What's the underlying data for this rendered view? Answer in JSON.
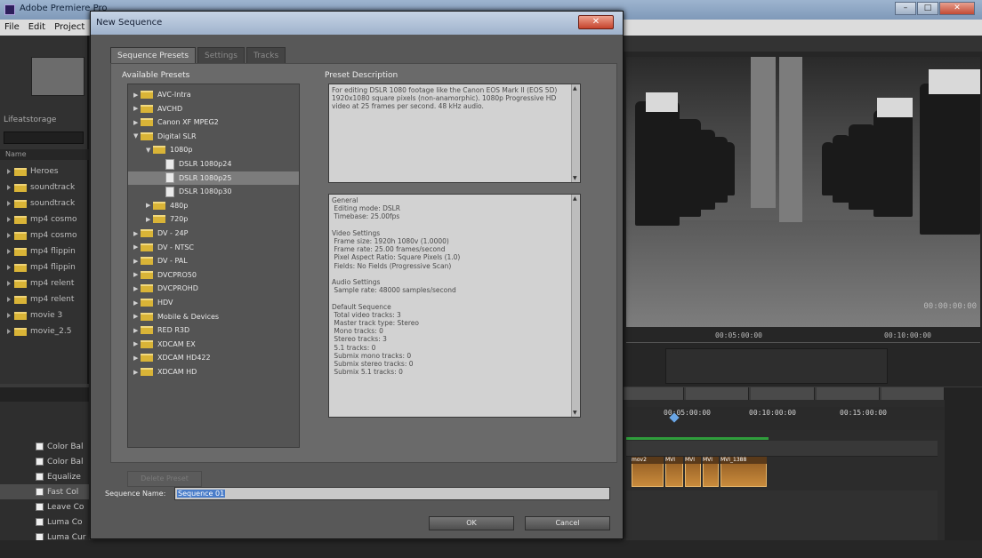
{
  "app": {
    "title": "Adobe Premiere Pro",
    "menu": [
      "File",
      "Edit",
      "Project"
    ],
    "window_controls": [
      "–",
      "□",
      "✕"
    ]
  },
  "project_panel": {
    "project_name": "Lifeatstorage",
    "column_header": "Name",
    "bins": [
      "Heroes",
      "soundtrack",
      "soundtrack",
      "mp4 cosmo",
      "mp4 cosmo",
      "mp4 flippin",
      "mp4 flippin",
      "mp4 relent",
      "mp4 relent",
      "movie 3",
      "movie_2.5"
    ]
  },
  "effects_panel": {
    "items": [
      "Color Bal",
      "Color Bal",
      "Equalize",
      "Fast Col",
      "Leave Co",
      "Luma Co",
      "Luma Cur"
    ],
    "selected_index": 3
  },
  "program_monitor": {
    "timecode_left": "00:00:00:00",
    "timecode_right": "00:00:00:00",
    "ruler": [
      "00:05:00:00",
      "00:10:00:00"
    ]
  },
  "timeline": {
    "ruler": [
      "00:05:00:00",
      "00:10:00:00",
      "00:15:00:00"
    ],
    "clip_labels": [
      "mov2",
      "MVI",
      "MVI",
      "MVI",
      "MVI_1388"
    ]
  },
  "dialog": {
    "title": "New Sequence",
    "close_label": "✕",
    "tabs": [
      {
        "label": "Sequence Presets",
        "active": true
      },
      {
        "label": "Settings",
        "active": false
      },
      {
        "label": "Tracks",
        "active": false
      }
    ],
    "available_presets_label": "Available Presets",
    "tree": [
      {
        "label": "AVC-Intra",
        "type": "folder",
        "level": 0,
        "expanded": false
      },
      {
        "label": "AVCHD",
        "type": "folder",
        "level": 0,
        "expanded": false
      },
      {
        "label": "Canon XF MPEG2",
        "type": "folder",
        "level": 0,
        "expanded": false
      },
      {
        "label": "Digital SLR",
        "type": "folder",
        "level": 0,
        "expanded": true
      },
      {
        "label": "1080p",
        "type": "folder",
        "level": 1,
        "expanded": true
      },
      {
        "label": "DSLR 1080p24",
        "type": "file",
        "level": 2
      },
      {
        "label": "DSLR 1080p25",
        "type": "file",
        "level": 2,
        "selected": true
      },
      {
        "label": "DSLR 1080p30",
        "type": "file",
        "level": 2
      },
      {
        "label": "480p",
        "type": "folder",
        "level": 1,
        "expanded": false
      },
      {
        "label": "720p",
        "type": "folder",
        "level": 1,
        "expanded": false
      },
      {
        "label": "DV - 24P",
        "type": "folder",
        "level": 0,
        "expanded": false
      },
      {
        "label": "DV - NTSC",
        "type": "folder",
        "level": 0,
        "expanded": false
      },
      {
        "label": "DV - PAL",
        "type": "folder",
        "level": 0,
        "expanded": false
      },
      {
        "label": "DVCPRO50",
        "type": "folder",
        "level": 0,
        "expanded": false
      },
      {
        "label": "DVCPROHD",
        "type": "folder",
        "level": 0,
        "expanded": false
      },
      {
        "label": "HDV",
        "type": "folder",
        "level": 0,
        "expanded": false
      },
      {
        "label": "Mobile & Devices",
        "type": "folder",
        "level": 0,
        "expanded": false
      },
      {
        "label": "RED R3D",
        "type": "folder",
        "level": 0,
        "expanded": false
      },
      {
        "label": "XDCAM EX",
        "type": "folder",
        "level": 0,
        "expanded": false
      },
      {
        "label": "XDCAM HD422",
        "type": "folder",
        "level": 0,
        "expanded": false
      },
      {
        "label": "XDCAM HD",
        "type": "folder",
        "level": 0,
        "expanded": false
      }
    ],
    "delete_preset_label": "Delete Preset",
    "preset_description_label": "Preset Description",
    "preset_description": "For editing DSLR 1080 footage like the Canon EOS Mark II (EOS 5D) 1920x1080 square pixels (non-anamorphic). 1080p Progressive HD video at 25 frames per second. 48 kHz audio.",
    "general_text": "General\n Editing mode: DSLR\n Timebase: 25.00fps\n\nVideo Settings\n Frame size: 1920h 1080v (1.0000)\n Frame rate: 25.00 frames/second\n Pixel Aspect Ratio: Square Pixels (1.0)\n Fields: No Fields (Progressive Scan)\n\nAudio Settings\n Sample rate: 48000 samples/second\n\nDefault Sequence\n Total video tracks: 3\n Master track type: Stereo\n Mono tracks: 0\n Stereo tracks: 3\n 5.1 tracks: 0\n Submix mono tracks: 0\n Submix stereo tracks: 0\n Submix 5.1 tracks: 0",
    "sequence_name_label": "Sequence Name:",
    "sequence_name_value": "Sequence 01",
    "ok_label": "OK",
    "cancel_label": "Cancel"
  }
}
